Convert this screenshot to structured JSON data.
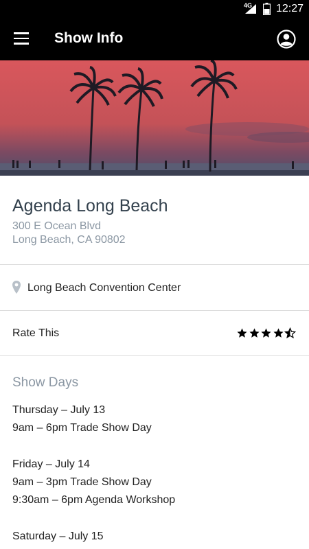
{
  "status_bar": {
    "network": "4G",
    "time": "12:27"
  },
  "app_bar": {
    "title": "Show Info",
    "menu_icon": "hamburger-menu-icon",
    "account_icon": "account-circle-icon"
  },
  "show": {
    "name": "Agenda Long Beach",
    "address_line1": "300 E Ocean Blvd",
    "address_line2": "Long Beach, CA 90802"
  },
  "venue": {
    "icon": "location-pin-icon",
    "name": "Long Beach Convention Center"
  },
  "rating": {
    "label": "Rate This",
    "value": 4.5,
    "max": 5
  },
  "show_days": {
    "heading": "Show Days",
    "groups": [
      {
        "day": "Thursday – July 13",
        "events": [
          "9am – 6pm Trade Show Day"
        ]
      },
      {
        "day": "Friday – July 14",
        "events": [
          "9am – 3pm Trade Show Day",
          "9:30am – 6pm Agenda Workshop"
        ]
      },
      {
        "day": "Saturday – July 15",
        "events": []
      }
    ]
  },
  "colors": {
    "bar_background": "#000000",
    "secondary_text": "#8b97a3",
    "title_text": "#33414d",
    "divider": "#dcdcdc"
  }
}
